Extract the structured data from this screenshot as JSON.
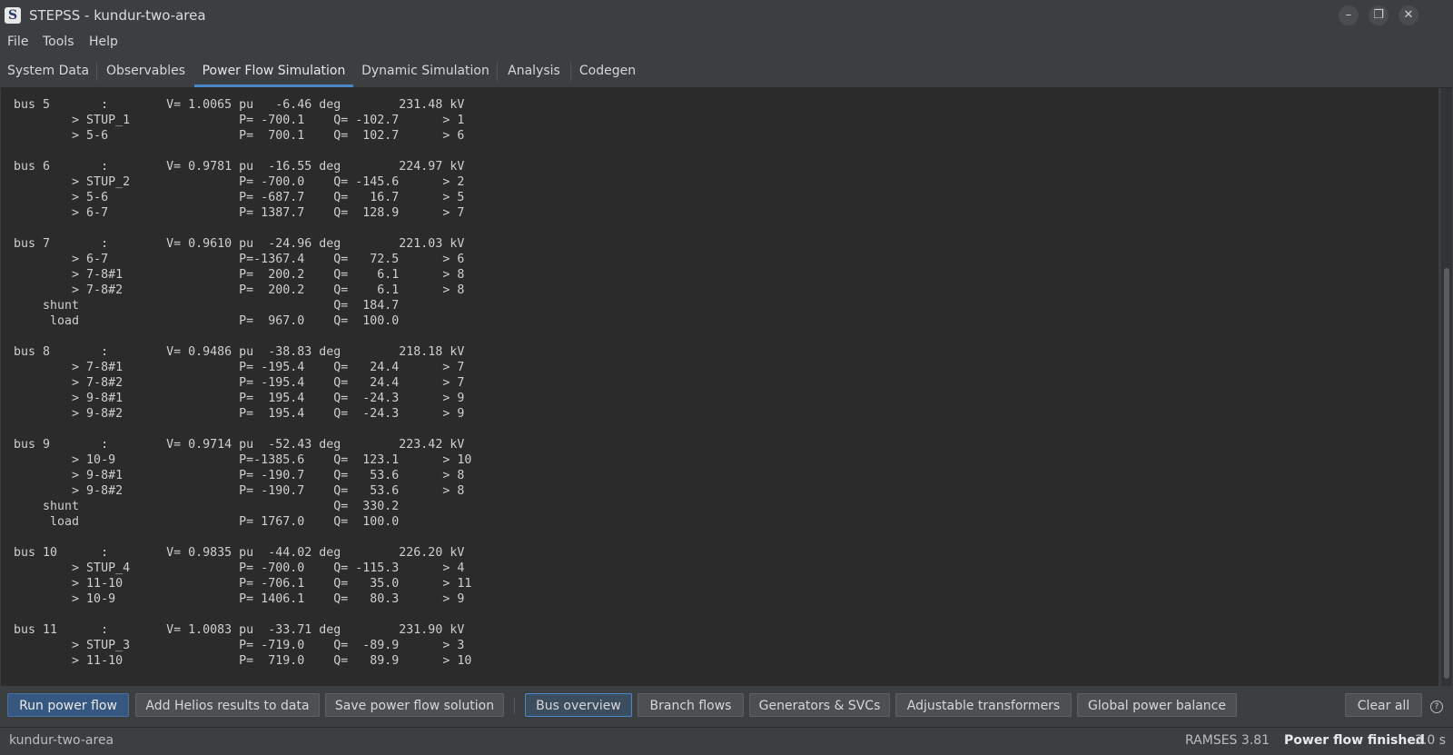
{
  "window": {
    "title": "STEPSS - kundur-two-area",
    "logo_letter": "S",
    "minimize_glyph": "–",
    "restore_glyph": "❐",
    "close_glyph": "✕"
  },
  "menu": [
    "File",
    "Tools",
    "Help"
  ],
  "tabs": [
    "System Data",
    "Observables",
    "Power Flow Simulation",
    "Dynamic Simulation",
    "Analysis",
    "Codegen"
  ],
  "active_tab": "Power Flow Simulation",
  "output_text": "bus 5       :        V= 1.0065 pu   -6.46 deg        231.48 kV\n        > STUP_1               P= -700.1    Q= -102.7      > 1\n        > 5-6                  P=  700.1    Q=  102.7      > 6\n\nbus 6       :        V= 0.9781 pu  -16.55 deg        224.97 kV\n        > STUP_2               P= -700.0    Q= -145.6      > 2\n        > 5-6                  P= -687.7    Q=   16.7      > 5\n        > 6-7                  P= 1387.7    Q=  128.9      > 7\n\nbus 7       :        V= 0.9610 pu  -24.96 deg        221.03 kV\n        > 6-7                  P=-1367.4    Q=   72.5      > 6\n        > 7-8#1                P=  200.2    Q=    6.1      > 8\n        > 7-8#2                P=  200.2    Q=    6.1      > 8\n    shunt                                   Q=  184.7\n     load                      P=  967.0    Q=  100.0\n\nbus 8       :        V= 0.9486 pu  -38.83 deg        218.18 kV\n        > 7-8#1                P= -195.4    Q=   24.4      > 7\n        > 7-8#2                P= -195.4    Q=   24.4      > 7\n        > 9-8#1                P=  195.4    Q=  -24.3      > 9\n        > 9-8#2                P=  195.4    Q=  -24.3      > 9\n\nbus 9       :        V= 0.9714 pu  -52.43 deg        223.42 kV\n        > 10-9                 P=-1385.6    Q=  123.1      > 10\n        > 9-8#1                P= -190.7    Q=   53.6      > 8\n        > 9-8#2                P= -190.7    Q=   53.6      > 8\n    shunt                                   Q=  330.2\n     load                      P= 1767.0    Q=  100.0\n\nbus 10      :        V= 0.9835 pu  -44.02 deg        226.20 kV\n        > STUP_4               P= -700.0    Q= -115.3      > 4\n        > 11-10                P= -706.1    Q=   35.0      > 11\n        > 10-9                 P= 1406.1    Q=   80.3      > 9\n\nbus 11      :        V= 1.0083 pu  -33.71 deg        231.90 kV\n        > STUP_3               P= -719.0    Q=  -89.9      > 3\n        > 11-10                P=  719.0    Q=   89.9      > 10",
  "buttons": {
    "run_power_flow": "Run power flow",
    "add_helios": "Add Helios results to data",
    "save_solution": "Save power flow solution",
    "bus_overview": "Bus overview",
    "branch_flows": "Branch flows",
    "generators_svcs": "Generators & SVCs",
    "adjustable_transformers": "Adjustable transformers",
    "global_power_balance": "Global power balance",
    "clear_all": "Clear all",
    "help_glyph": "?"
  },
  "status": {
    "project": "kundur-two-area",
    "version": "RAMSES 3.81",
    "state": "Power flow finished",
    "time": "3.0 s"
  },
  "colors": {
    "background": "#3c3f41",
    "output_background": "#2b2b2b",
    "accent": "#4a88c7",
    "primary_button": "#365880"
  }
}
